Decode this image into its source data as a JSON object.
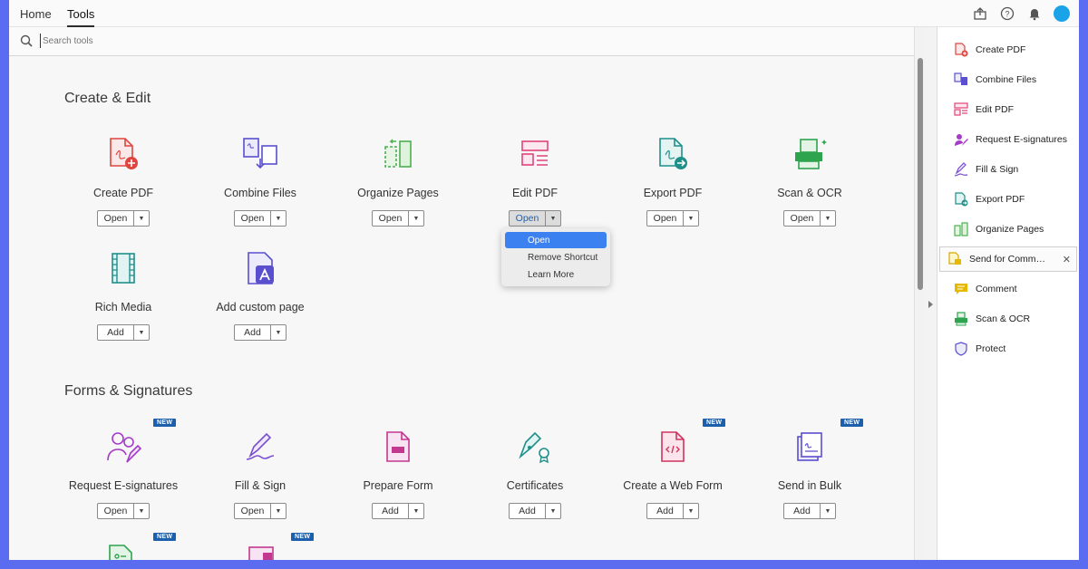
{
  "nav": {
    "home": "Home",
    "tools": "Tools"
  },
  "search": {
    "placeholder": "Search tools"
  },
  "sections": {
    "create_edit": "Create & Edit",
    "forms_signatures": "Forms & Signatures"
  },
  "create_edit_tools": [
    {
      "label": "Create PDF",
      "button": "Open",
      "icon": "create-pdf-icon"
    },
    {
      "label": "Combine Files",
      "button": "Open",
      "icon": "combine-files-icon"
    },
    {
      "label": "Organize Pages",
      "button": "Open",
      "icon": "organize-pages-icon"
    },
    {
      "label": "Edit PDF",
      "button": "Open",
      "icon": "edit-pdf-icon"
    },
    {
      "label": "Export PDF",
      "button": "Open",
      "icon": "export-pdf-icon"
    },
    {
      "label": "Scan & OCR",
      "button": "Open",
      "icon": "scan-ocr-icon"
    },
    {
      "label": "Rich Media",
      "button": "Add",
      "icon": "rich-media-icon"
    },
    {
      "label": "Add custom page",
      "button": "Add",
      "icon": "add-custom-page-icon"
    }
  ],
  "forms_tools": [
    {
      "label": "Request E-signatures",
      "button": "Open",
      "icon": "request-esignatures-icon",
      "badge": "NEW"
    },
    {
      "label": "Fill & Sign",
      "button": "Open",
      "icon": "fill-sign-icon"
    },
    {
      "label": "Prepare Form",
      "button": "Add",
      "icon": "prepare-form-icon"
    },
    {
      "label": "Certificates",
      "button": "Add",
      "icon": "certificates-icon"
    },
    {
      "label": "Create a Web Form",
      "button": "Add",
      "icon": "web-form-icon",
      "badge": "NEW"
    },
    {
      "label": "Send in Bulk",
      "button": "Add",
      "icon": "send-in-bulk-icon",
      "badge": "NEW"
    }
  ],
  "partial_row_badges": [
    "NEW",
    "NEW"
  ],
  "dropdown_menu": [
    "Open",
    "Remove Shortcut",
    "Learn More"
  ],
  "right_panel": [
    {
      "label": "Create PDF",
      "icon": "create-pdf-icon",
      "color": "#e0443e"
    },
    {
      "label": "Combine Files",
      "icon": "combine-files-icon",
      "color": "#5a4fcf"
    },
    {
      "label": "Edit PDF",
      "icon": "edit-pdf-icon",
      "color": "#e0447a"
    },
    {
      "label": "Request E-signatures",
      "icon": "request-esignatures-icon",
      "color": "#a53bc7"
    },
    {
      "label": "Fill & Sign",
      "icon": "fill-sign-icon",
      "color": "#7a4fd0"
    },
    {
      "label": "Export PDF",
      "icon": "export-pdf-icon",
      "color": "#1f8f8a"
    },
    {
      "label": "Organize Pages",
      "icon": "organize-pages-icon",
      "color": "#4caf50"
    },
    {
      "label": "Send for Comm…",
      "icon": "send-for-comment-icon",
      "color": "#e6b800",
      "selected": true
    },
    {
      "label": "Comment",
      "icon": "comment-icon",
      "color": "#e6b800"
    },
    {
      "label": "Scan & OCR",
      "icon": "scan-ocr-icon",
      "color": "#2ea44f"
    },
    {
      "label": "Protect",
      "icon": "protect-icon",
      "color": "#5a4fcf"
    }
  ],
  "colors": {
    "accent": "#3b82f0",
    "badge": "#1c5fad",
    "background_frame": "#5b6cf0"
  }
}
